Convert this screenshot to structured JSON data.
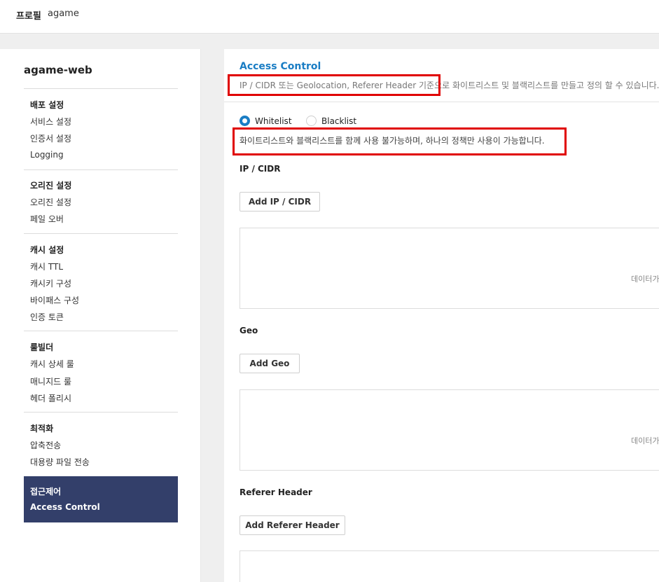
{
  "header": {
    "label": "프로필",
    "value": "agame"
  },
  "sidebar": {
    "title": "agame-web",
    "groups": [
      {
        "title": "배포 설정",
        "items": [
          "서비스 설정",
          "인증서 설정",
          "Logging"
        ]
      },
      {
        "title": "오리진 설정",
        "items": [
          "오리진 설정",
          "페일 오버"
        ]
      },
      {
        "title": "캐시 설정",
        "items": [
          "캐시 TTL",
          "캐시키 구성",
          "바이패스 구성",
          "인증 토큰"
        ]
      },
      {
        "title": "룰빌더",
        "items": [
          "캐시 상세 룰",
          "매니지드 룰",
          "헤더 폴리시"
        ]
      },
      {
        "title": "최적화",
        "items": [
          "압축전송",
          "대용량 파일 전송"
        ]
      },
      {
        "title": "접근제어",
        "items": [
          "Access Control"
        ]
      }
    ]
  },
  "main": {
    "title": "Access Control",
    "description": "IP / CIDR 또는 Geolocation, Referer Header 기준으로 화이트리스트 및 블랙리스트를 만들고 정의 할 수 있습니다.",
    "radios": {
      "whitelist": "Whitelist",
      "blacklist": "Blacklist",
      "selected": "Whitelist"
    },
    "note": "화이트리스트와 블랙리스트를 함께 사용 불가능하며, 하나의 정책만 사용이 가능합니다.",
    "sections": [
      {
        "label": "IP / CIDR",
        "button": "Add IP / CIDR",
        "empty": "데이터가"
      },
      {
        "label": "Geo",
        "button": "Add Geo",
        "empty": "데이터가"
      },
      {
        "label": "Referer Header",
        "button": "Add Referer Header",
        "empty": ""
      }
    ]
  },
  "colors": {
    "accent": "#1a7dc4",
    "active_nav": "#333f6a",
    "highlight": "#e00000"
  }
}
